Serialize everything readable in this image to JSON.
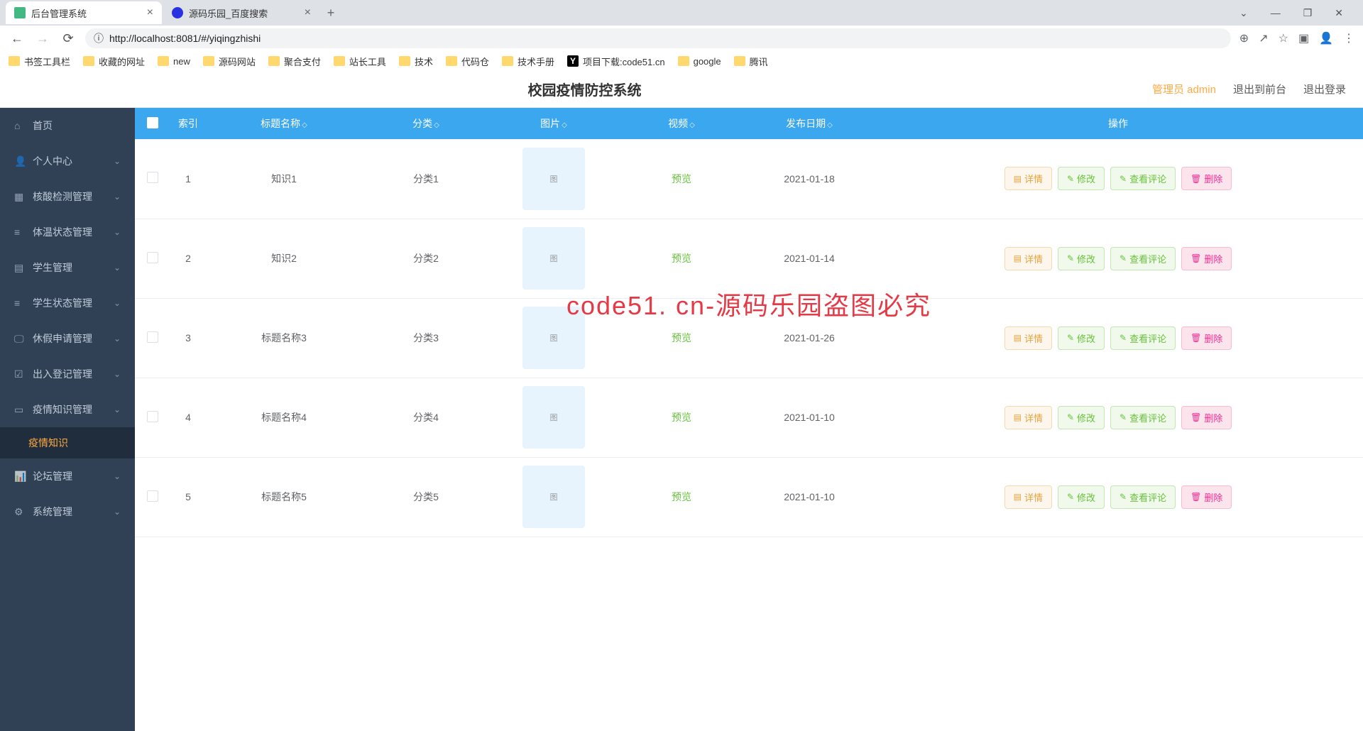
{
  "browser": {
    "tabs": [
      {
        "title": "后台管理系统",
        "active": true
      },
      {
        "title": "源码乐园_百度搜索",
        "active": false
      }
    ],
    "url_info_icon": "ⓘ",
    "url_full": "http://localhost:8081/#/yiqingzhishi",
    "bookmarks": [
      "书签工具栏",
      "收藏的网址",
      "new",
      "源码网站",
      "聚合支付",
      "站长工具",
      "技术",
      "代码仓",
      "技术手册",
      "项目下载:code51.cn",
      "google",
      "腾讯"
    ]
  },
  "header": {
    "title": "校园疫情防控系统",
    "user": "管理员 admin",
    "exit_front": "退出到前台",
    "logout": "退出登录"
  },
  "sidebar": {
    "items": [
      {
        "label": "首页",
        "icon": "home",
        "expandable": false
      },
      {
        "label": "个人中心",
        "icon": "user",
        "expandable": true
      },
      {
        "label": "核酸检测管理",
        "icon": "bars",
        "expandable": true
      },
      {
        "label": "体温状态管理",
        "icon": "list",
        "expandable": true
      },
      {
        "label": "学生管理",
        "icon": "file",
        "expandable": true
      },
      {
        "label": "学生状态管理",
        "icon": "list",
        "expandable": true
      },
      {
        "label": "休假申请管理",
        "icon": "monitor",
        "expandable": true
      },
      {
        "label": "出入登记管理",
        "icon": "form",
        "expandable": true
      },
      {
        "label": "疫情知识管理",
        "icon": "book",
        "expandable": true,
        "expanded": true,
        "children": [
          {
            "label": "疫情知识"
          }
        ]
      },
      {
        "label": "论坛管理",
        "icon": "chart",
        "expandable": true
      },
      {
        "label": "系统管理",
        "icon": "gear",
        "expandable": true
      }
    ]
  },
  "table": {
    "columns": {
      "index": "索引",
      "title": "标题名称",
      "category": "分类",
      "image": "图片",
      "video": "视频",
      "date": "发布日期",
      "action": "操作"
    },
    "video_label": "预览",
    "actions": {
      "detail": "详情",
      "edit": "修改",
      "comment": "查看评论",
      "delete": "删除"
    },
    "rows": [
      {
        "index": 1,
        "title": "知识1",
        "category": "分类1",
        "date": "2021-01-18"
      },
      {
        "index": 2,
        "title": "知识2",
        "category": "分类2",
        "date": "2021-01-14"
      },
      {
        "index": 3,
        "title": "标题名称3",
        "category": "分类3",
        "date": "2021-01-26"
      },
      {
        "index": 4,
        "title": "标题名称4",
        "category": "分类4",
        "date": "2021-01-10"
      },
      {
        "index": 5,
        "title": "标题名称5",
        "category": "分类5",
        "date": "2021-01-10"
      }
    ]
  },
  "watermark": "code51. cn-源码乐园盗图必究"
}
